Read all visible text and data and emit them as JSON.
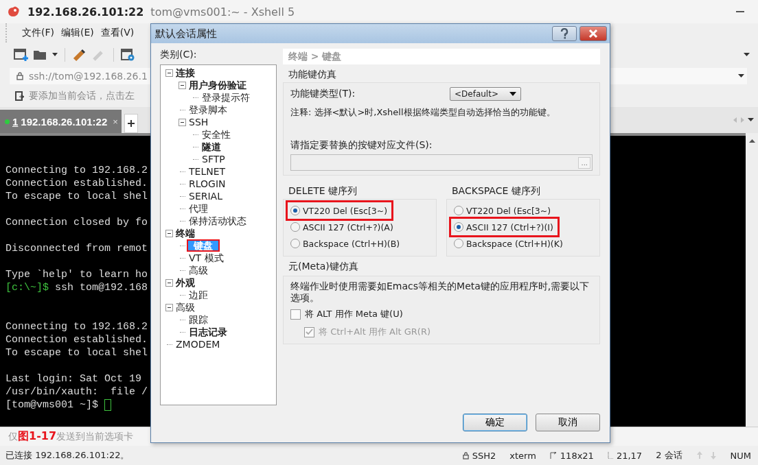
{
  "window": {
    "host": "192.168.26.101:22",
    "title": "tom@vms001:~ - Xshell 5"
  },
  "menu": [
    "文件(F)",
    "编辑(E)",
    "查看(V)"
  ],
  "address": {
    "value": "ssh://tom@192.168.26.1"
  },
  "hint": "要添加当前会话，点击左",
  "tabs": [
    {
      "number": "1",
      "label": "192.168.26.101:22",
      "selected": true,
      "connected": true,
      "close": "×"
    }
  ],
  "terminal": {
    "lines": [
      {
        "kind": "blank"
      },
      {
        "kind": "output",
        "text": "Connecting to 192.168.2"
      },
      {
        "kind": "output",
        "text": "Connection established."
      },
      {
        "kind": "output",
        "text": "To escape to local shel"
      },
      {
        "kind": "blank"
      },
      {
        "kind": "output",
        "text": "Connection closed by fo"
      },
      {
        "kind": "blank"
      },
      {
        "kind": "output",
        "text": "Disconnected from remot"
      },
      {
        "kind": "blank"
      },
      {
        "kind": "output",
        "text": "Type `help' to learn ho"
      },
      {
        "kind": "prompt",
        "prompt": "[c:\\~]$",
        "text": " ssh tom@192.168"
      },
      {
        "kind": "blank"
      },
      {
        "kind": "blank"
      },
      {
        "kind": "output",
        "text": "Connecting to 192.168.2"
      },
      {
        "kind": "output",
        "text": "Connection established."
      },
      {
        "kind": "output",
        "text": "To escape to local shel"
      },
      {
        "kind": "blank"
      },
      {
        "kind": "output",
        "text": "Last login: Sat Oct 19"
      },
      {
        "kind": "output",
        "text": "/usr/bin/xauth:  file /"
      },
      {
        "kind": "input",
        "text": "[tom@vms001 ~]$ "
      }
    ]
  },
  "input_bar": {
    "lead": "仅",
    "figure_label": "图1-17",
    "placeholder": "发送到当前选项卡"
  },
  "status_bar": {
    "message": "已连接 192.168.26.101:22。",
    "items": [
      {
        "kind": "protocol",
        "text": "SSH2"
      },
      {
        "kind": "plain",
        "text": "xterm"
      },
      {
        "kind": "size",
        "text": "118x21"
      },
      {
        "kind": "cursor",
        "text": "21,17"
      },
      {
        "kind": "plain",
        "text": "2 会话"
      },
      {
        "kind": "arrows"
      },
      {
        "kind": "plain",
        "text": "NUM"
      }
    ]
  },
  "dialog": {
    "title": "默认会话属性",
    "category_label": "类别(C):",
    "tree": [
      {
        "label": "连接",
        "bold": true,
        "selected": false,
        "highlighted": false,
        "expanded": true,
        "children": [
          {
            "label": "用户身份验证",
            "bold": true,
            "selected": false,
            "highlighted": false,
            "expanded": true,
            "children": [
              {
                "label": "登录提示符",
                "bold": false,
                "selected": false,
                "highlighted": false
              }
            ]
          },
          {
            "label": "登录脚本",
            "bold": false,
            "selected": false,
            "highlighted": false
          },
          {
            "label": "SSH",
            "bold": false,
            "selected": false,
            "highlighted": false,
            "expanded": true,
            "children": [
              {
                "label": "安全性",
                "bold": false,
                "selected": false,
                "highlighted": false
              },
              {
                "label": "隧道",
                "bold": true,
                "selected": false,
                "highlighted": false
              },
              {
                "label": "SFTP",
                "bold": false,
                "selected": false,
                "highlighted": false
              }
            ]
          },
          {
            "label": "TELNET",
            "bold": false,
            "selected": false,
            "highlighted": false
          },
          {
            "label": "RLOGIN",
            "bold": false,
            "selected": false,
            "highlighted": false
          },
          {
            "label": "SERIAL",
            "bold": false,
            "selected": false,
            "highlighted": false
          },
          {
            "label": "代理",
            "bold": false,
            "selected": false,
            "highlighted": false
          },
          {
            "label": "保持活动状态",
            "bold": false,
            "selected": false,
            "highlighted": false
          }
        ]
      },
      {
        "label": "终端",
        "bold": true,
        "selected": false,
        "highlighted": false,
        "expanded": true,
        "children": [
          {
            "label": "键盘",
            "bold": true,
            "selected": true,
            "highlighted": true
          },
          {
            "label": "VT 模式",
            "bold": false,
            "selected": false,
            "highlighted": false
          },
          {
            "label": "高级",
            "bold": false,
            "selected": false,
            "highlighted": false
          }
        ]
      },
      {
        "label": "外观",
        "bold": true,
        "selected": false,
        "highlighted": false,
        "expanded": true,
        "children": [
          {
            "label": "边距",
            "bold": false,
            "selected": false,
            "highlighted": false
          }
        ]
      },
      {
        "label": "高级",
        "bold": false,
        "selected": false,
        "highlighted": false,
        "expanded": true,
        "children": [
          {
            "label": "跟踪",
            "bold": false,
            "selected": false,
            "highlighted": false
          },
          {
            "label": "日志记录",
            "bold": true,
            "selected": false,
            "highlighted": false
          }
        ]
      },
      {
        "label": "ZMODEM",
        "bold": false,
        "selected": false,
        "highlighted": false
      }
    ],
    "breadcrumb": "终端 > 键盘",
    "function_keys": {
      "title": "功能键仿真",
      "type_label": "功能键类型(T):",
      "type_value": "<Default>",
      "note": "注释: 选择<默认>时,Xshell根据终端类型自动选择恰当的功能键。",
      "file_label": "请指定要替换的按键对应文件(S):",
      "browse": "..."
    },
    "key_groups": [
      {
        "title": "DELETE 键序列",
        "options": [
          {
            "label": "VT220 Del (Esc[3~)",
            "selected": true,
            "highlighted": true
          },
          {
            "label": "ASCII 127 (Ctrl+?)(A)",
            "selected": false,
            "highlighted": false
          },
          {
            "label": "Backspace (Ctrl+H)(B)",
            "selected": false,
            "highlighted": false
          }
        ]
      },
      {
        "title": "BACKSPACE 键序列",
        "options": [
          {
            "label": "VT220 Del (Esc[3~)",
            "selected": false,
            "highlighted": false
          },
          {
            "label": "ASCII 127 (Ctrl+?)(I)",
            "selected": true,
            "highlighted": true
          },
          {
            "label": "Backspace (Ctrl+H)(K)",
            "selected": false,
            "highlighted": false
          }
        ]
      }
    ],
    "meta": {
      "title": "元(Meta)键仿真",
      "description": "终端作业时使用需要如Emacs等相关的Meta键的应用程序时,需要以下选项。",
      "options": [
        {
          "label": "将 ALT 用作 Meta 键(U)",
          "checked": false,
          "disabled": false
        },
        {
          "label": "将 Ctrl+Alt 用作 Alt GR(R)",
          "checked": true,
          "disabled": true
        }
      ]
    },
    "buttons": [
      {
        "label": "确定",
        "default": true
      },
      {
        "label": "取消",
        "default": false
      }
    ]
  }
}
